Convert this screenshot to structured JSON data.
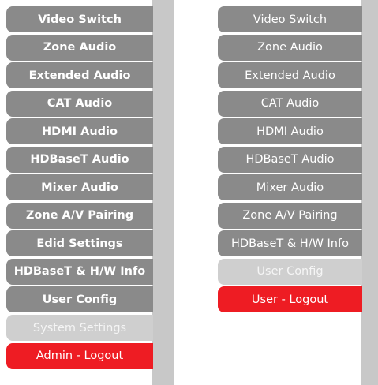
{
  "admin_menu": {
    "items": [
      {
        "label": "Video Switch",
        "state": "normal"
      },
      {
        "label": "Zone Audio",
        "state": "normal"
      },
      {
        "label": "Extended Audio",
        "state": "normal"
      },
      {
        "label": "CAT Audio",
        "state": "normal"
      },
      {
        "label": "HDMI Audio",
        "state": "normal"
      },
      {
        "label": "HDBaseT Audio",
        "state": "normal"
      },
      {
        "label": "Mixer Audio",
        "state": "normal"
      },
      {
        "label": "Zone A/V Pairing",
        "state": "normal"
      },
      {
        "label": "Edid Settings",
        "state": "normal"
      },
      {
        "label": "HDBaseT & H/W Info",
        "state": "normal"
      },
      {
        "label": "User Config",
        "state": "normal"
      },
      {
        "label": "System Settings",
        "state": "active"
      },
      {
        "label": "Admin - Logout",
        "state": "logout"
      }
    ]
  },
  "user_menu": {
    "items": [
      {
        "label": "Video Switch",
        "state": "normal"
      },
      {
        "label": "Zone Audio",
        "state": "normal"
      },
      {
        "label": "Extended Audio",
        "state": "normal"
      },
      {
        "label": "CAT Audio",
        "state": "normal"
      },
      {
        "label": "HDMI Audio",
        "state": "normal"
      },
      {
        "label": "HDBaseT Audio",
        "state": "normal"
      },
      {
        "label": "Mixer Audio",
        "state": "normal"
      },
      {
        "label": "Zone A/V Pairing",
        "state": "normal"
      },
      {
        "label": "HDBaseT & H/W Info",
        "state": "normal"
      },
      {
        "label": "User Config",
        "state": "active"
      },
      {
        "label": "User - Logout",
        "state": "logout"
      }
    ]
  },
  "colors": {
    "item_normal": "#8a8a8a",
    "item_active": "#cfcfcf",
    "item_logout": "#ee1c23",
    "scroll_track": "#c8c8c8"
  }
}
